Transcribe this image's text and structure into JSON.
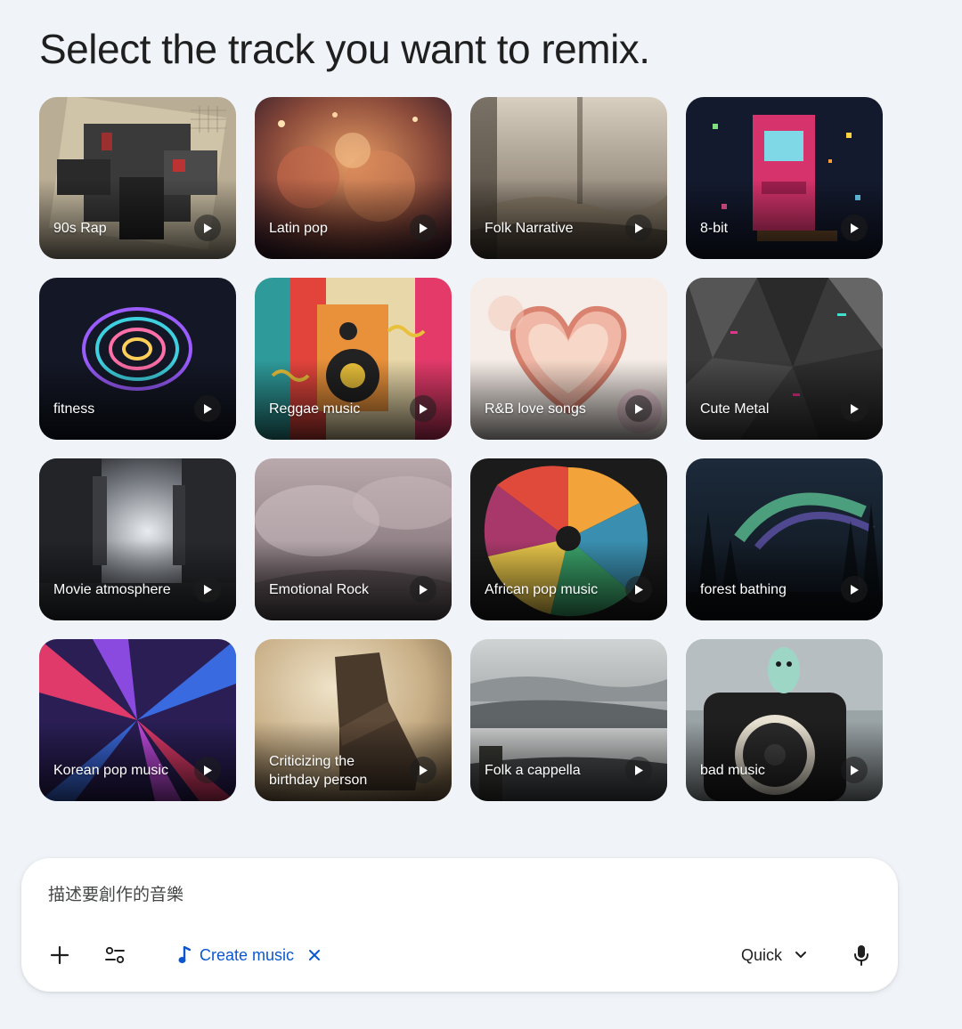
{
  "heading": "Select the track you want to remix.",
  "tracks": [
    {
      "label": "90s Rap"
    },
    {
      "label": "Latin pop"
    },
    {
      "label": "Folk Narrative"
    },
    {
      "label": "8-bit"
    },
    {
      "label": "fitness"
    },
    {
      "label": "Reggae music"
    },
    {
      "label": "R&B love songs"
    },
    {
      "label": "Cute Metal"
    },
    {
      "label": "Movie atmosphere"
    },
    {
      "label": "Emotional Rock"
    },
    {
      "label": "African pop music"
    },
    {
      "label": "forest bathing"
    },
    {
      "label": "Korean pop music"
    },
    {
      "label": "Criticizing the birthday person"
    },
    {
      "label": "Folk a cappella"
    },
    {
      "label": "bad music"
    }
  ],
  "composer": {
    "placeholder": "描述要創作的音樂",
    "create_chip_label": "Create music",
    "mode_label": "Quick",
    "icons": [
      "plus-icon",
      "tune-icon",
      "music-note-icon",
      "close-icon",
      "chevron-down-icon",
      "mic-icon"
    ]
  },
  "colors": {
    "background": "#f0f4f9",
    "accent": "#0b57d0"
  }
}
